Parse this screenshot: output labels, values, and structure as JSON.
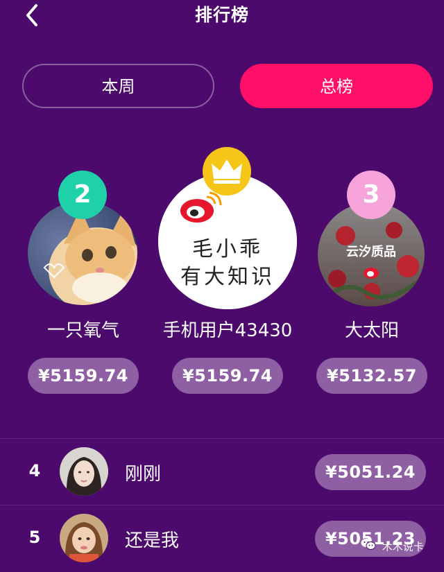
{
  "header": {
    "title": "排行榜",
    "back_icon": "chevron-left-icon"
  },
  "tabs": [
    {
      "label": "本周",
      "active": false
    },
    {
      "label": "总榜",
      "active": true
    }
  ],
  "podium": [
    {
      "rank": "2",
      "name": "一只氧气",
      "amount": "¥5159.74",
      "badge_color": "#1fd1a8",
      "avatar": "kitten-photo"
    },
    {
      "rank": "1",
      "name": "手机用户43430",
      "amount": "¥5159.74",
      "badge_color": "#f5c518",
      "badge_icon": "crown-icon",
      "avatar": "weibo-text-avatar",
      "avatar_text": [
        "毛小乖",
        "有大知识"
      ]
    },
    {
      "rank": "3",
      "name": "大太阳",
      "amount": "¥5132.57",
      "badge_color": "#f5a3d8",
      "avatar": "roses-photo",
      "avatar_text": [
        "云汐质品"
      ]
    }
  ],
  "list": [
    {
      "rank": "4",
      "name": "刚刚",
      "amount": "¥5051.24",
      "avatar": "woman-portrait"
    },
    {
      "rank": "5",
      "name": "还是我",
      "amount": "¥5051.23",
      "avatar": "woman-portrait-2"
    }
  ],
  "watermark": {
    "text": "木木说卡",
    "icon": "wechat-icon"
  },
  "colors": {
    "background": "#4b0a6c",
    "accent": "#ff1068",
    "pill": "#8e5fa3"
  }
}
